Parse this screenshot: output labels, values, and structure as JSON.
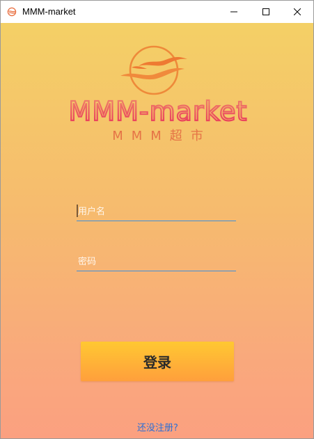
{
  "window": {
    "title": "MMM-market"
  },
  "logo": {
    "wordmark": "MMM-market",
    "subtitle": "MMM超市"
  },
  "form": {
    "username_placeholder": "用户名",
    "password_placeholder": "密码",
    "login_label": "登录",
    "register_link": "还没注册?"
  },
  "colors": {
    "gradient_top": "#f4d066",
    "gradient_bottom": "#fba080",
    "logo_orange": "#ee7a32",
    "logo_pink": "#e8325a",
    "button_top": "#ffc832",
    "button_bottom": "#ff9f3c",
    "link": "#2b6fd6",
    "field_underline": "#3f8fd8"
  },
  "icons": {
    "app": "mmm-logo-icon",
    "minimize": "minimize-icon",
    "maximize": "maximize-icon",
    "close": "close-icon"
  }
}
